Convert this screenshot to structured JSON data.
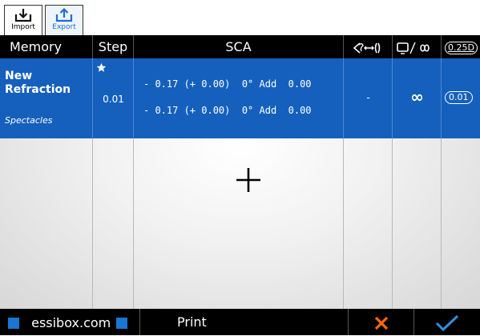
{
  "tabs": {
    "import_label": "Import",
    "export_label": "Export"
  },
  "header": {
    "memory": "Memory",
    "step": "Step",
    "sca": "SCA",
    "col6_badge": "0.25D"
  },
  "row": {
    "name_line1": "New",
    "name_line2": "Refraction",
    "type": "Spectacles",
    "step": "0.01",
    "sca_line1": "- 0.17 (+ 0.00)  0° Add  0.00",
    "sca_line2": "- 0.17 (+ 0.00)  0° Add  0.00",
    "col4_value": "-",
    "col5_value": "∞",
    "col6_value": "0.01"
  },
  "footer": {
    "website": "essibox.com",
    "print": "Print"
  },
  "colors": {
    "selected_row": "#1560bd",
    "accent_blue": "#1976d2",
    "cancel_orange": "#ff6a00",
    "confirm_blue": "#2f8fe0"
  }
}
